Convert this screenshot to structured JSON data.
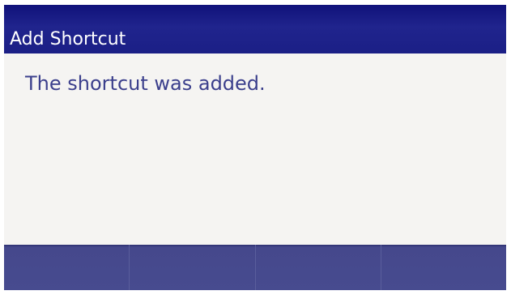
{
  "title_bar": {
    "title": "Add Shortcut"
  },
  "content": {
    "message": "The shortcut was added."
  },
  "softkeys": [
    {
      "label": ""
    },
    {
      "label": ""
    },
    {
      "label": ""
    },
    {
      "label": ""
    }
  ],
  "colors": {
    "title_bar": "#1b1f86",
    "content_bg": "#f5f4f2",
    "message_text": "#3b3f8c",
    "softkey_bar": "#474b8f"
  }
}
